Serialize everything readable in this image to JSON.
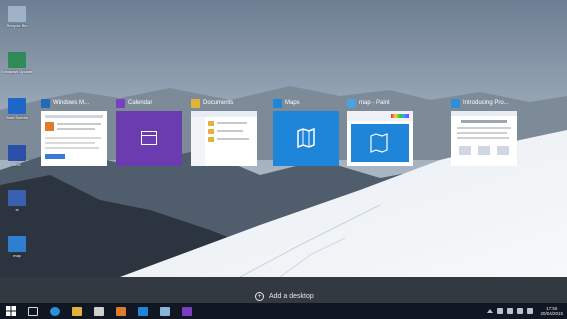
{
  "desktop_icons": [
    {
      "name": "recycle-bin-icon",
      "label": "Recycle Bin",
      "color": "#9fb3c8"
    },
    {
      "name": "windows-update-icon",
      "label": "Windows Update",
      "color": "#2e8b57"
    },
    {
      "name": "start-screen-icon",
      "label": "Start Screen",
      "color": "#1e66c8"
    },
    {
      "name": "desktop-folder-icon",
      "label": "DMC",
      "color": "#2a4fa8"
    },
    {
      "name": "shortcut-icon",
      "label": "st",
      "color": "#3a5fb0"
    },
    {
      "name": "map-icon",
      "label": "map",
      "color": "#2e7fcf"
    }
  ],
  "task_view": {
    "windows": [
      {
        "title": "Windows M...",
        "icon": "media-player-icon",
        "icon_color": "#1f6bb8",
        "thumb": "document"
      },
      {
        "title": "Calendar",
        "icon": "calendar-icon",
        "icon_color": "#7a3fc0",
        "thumb": "purple"
      },
      {
        "title": "Documents",
        "icon": "folder-icon",
        "icon_color": "#e2b33c",
        "thumb": "explorer"
      },
      {
        "title": "Maps",
        "icon": "maps-icon",
        "icon_color": "#1e85d8",
        "thumb": "blue"
      },
      {
        "title": "map - Paint",
        "icon": "paint-icon",
        "icon_color": "#4da3e0",
        "thumb": "paint"
      },
      {
        "title": "Introducing Pro...",
        "icon": "ie-icon",
        "icon_color": "#2e8fd8",
        "thumb": "web"
      }
    ]
  },
  "add_desktop": {
    "label": "Add a desktop"
  },
  "taskbar": {
    "items": [
      {
        "name": "start-button",
        "icon": "windows-logo-icon",
        "color": "#ffffff"
      },
      {
        "name": "task-view-button",
        "icon": "task-view-icon",
        "color": "#d9d9d9"
      },
      {
        "name": "ie-taskbar-button",
        "icon": "ie-icon",
        "color": "#2e8fd8"
      },
      {
        "name": "explorer-taskbar-button",
        "icon": "folder-icon",
        "color": "#e2b33c"
      },
      {
        "name": "store-taskbar-button",
        "icon": "store-icon",
        "color": "#cfcfcf"
      },
      {
        "name": "media-taskbar-button",
        "icon": "media-player-icon",
        "color": "#e07b2c"
      },
      {
        "name": "maps-taskbar-button",
        "icon": "maps-icon",
        "color": "#1e85d8"
      },
      {
        "name": "paint-taskbar-button",
        "icon": "paint-icon",
        "color": "#8ab4d8"
      },
      {
        "name": "calendar-taskbar-button",
        "icon": "calendar-icon",
        "color": "#7a3fc0"
      }
    ],
    "clock_time": "17:50",
    "clock_date": "20/04/2015"
  }
}
